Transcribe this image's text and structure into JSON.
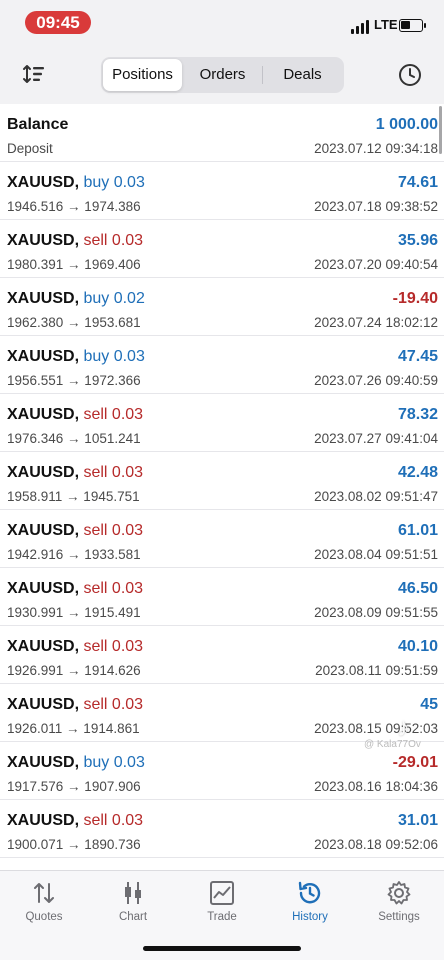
{
  "status_bar": {
    "time": "09:45",
    "network": "LTE",
    "time_pill_color": "#d93a3a"
  },
  "toolbar": {
    "sort_icon": "sort-icon",
    "tabs": [
      "Positions",
      "Orders",
      "Deals"
    ],
    "active_tab": "Positions",
    "history_icon": "clock-icon"
  },
  "balance": {
    "title": "Balance",
    "amount": "1 000.00",
    "subtitle": "Deposit",
    "time": "2023.07.12 09:34:18"
  },
  "trades": [
    {
      "symbol": "XAUUSD,",
      "direction": "buy 0.03",
      "prices": "1946.516 → 1974.386",
      "profit": "74.61",
      "time": "2023.07.18 09:38:52"
    },
    {
      "symbol": "XAUUSD,",
      "direction": "sell 0.03",
      "prices": "1980.391 → 1969.406",
      "profit": "35.96",
      "time": "2023.07.20 09:40:54"
    },
    {
      "symbol": "XAUUSD,",
      "direction": "buy 0.02",
      "prices": "1962.380 → 1953.681",
      "profit": "-19.40",
      "time": "2023.07.24 18:02:12"
    },
    {
      "symbol": "XAUUSD,",
      "direction": "buy 0.03",
      "prices": "1956.551 → 1972.366",
      "profit": "47.45",
      "time": "2023.07.26 09:40:59"
    },
    {
      "symbol": "XAUUSD,",
      "direction": "sell 0.03",
      "prices": "1976.346 → 1051.241",
      "profit": "78.32",
      "time": "2023.07.27 09:41:04"
    },
    {
      "symbol": "XAUUSD,",
      "direction": "sell 0.03",
      "prices": "1958.911 → 1945.751",
      "profit": "42.48",
      "time": "2023.08.02 09:51:47"
    },
    {
      "symbol": "XAUUSD,",
      "direction": "sell 0.03",
      "prices": "1942.916 → 1933.581",
      "profit": "61.01",
      "time": "2023.08.04 09:51:51"
    },
    {
      "symbol": "XAUUSD,",
      "direction": "sell 0.03",
      "prices": "1930.991 → 1915.491",
      "profit": "46.50",
      "time": "2023.08.09 09:51:55"
    },
    {
      "symbol": "XAUUSD,",
      "direction": "sell 0.03",
      "prices": "1926.991 → 1914.626",
      "profit": "40.10",
      "time": "2023.08.11 09:51:59"
    },
    {
      "symbol": "XAUUSD,",
      "direction": "sell 0.03",
      "prices": "1926.011 → 1914.861",
      "profit": "45",
      "time": "2023.08.15 09:52:03"
    },
    {
      "symbol": "XAUUSD,",
      "direction": "buy 0.03",
      "prices": "1917.576 → 1907.906",
      "profit": "-29.01",
      "time": "2023.08.16 18:04:36"
    },
    {
      "symbol": "XAUUSD,",
      "direction": "sell 0.03",
      "prices": "1900.071 → 1890.736",
      "profit": "31.01",
      "time": "2023.08.18 09:52:06"
    }
  ],
  "watermark": {
    "icon": "tiktok-icon",
    "handle": "@ Kala77Ov"
  },
  "tabbar": {
    "items": [
      {
        "label": "Quotes",
        "icon": "quotes-arrows-icon"
      },
      {
        "label": "Chart",
        "icon": "candlestick-chart-icon"
      },
      {
        "label": "Trade",
        "icon": "trade-chart-icon"
      },
      {
        "label": "History",
        "icon": "history-clock-icon"
      },
      {
        "label": "Settings",
        "icon": "gear-icon"
      }
    ],
    "active": "History"
  },
  "colors": {
    "buy_blue": "#1f6fb8",
    "sell_red": "#b62a2a",
    "profit_blue": "#1f6fb8",
    "loss_red": "#b62a2a",
    "accent": "#1f6fb8"
  }
}
